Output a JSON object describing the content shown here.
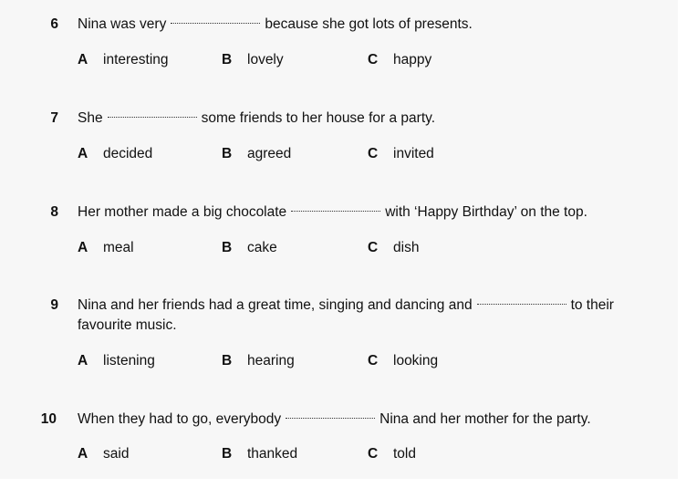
{
  "questions": [
    {
      "number": "6",
      "before": "Nina was very",
      "after": "because she got lots of presents.",
      "options": [
        {
          "letter": "A",
          "text": "interesting"
        },
        {
          "letter": "B",
          "text": "lovely"
        },
        {
          "letter": "C",
          "text": "happy"
        }
      ]
    },
    {
      "number": "7",
      "before": "She",
      "after": "some friends to her house for a party.",
      "options": [
        {
          "letter": "A",
          "text": "decided"
        },
        {
          "letter": "B",
          "text": "agreed"
        },
        {
          "letter": "C",
          "text": "invited"
        }
      ]
    },
    {
      "number": "8",
      "before": "Her mother made a big chocolate",
      "after": "with ‘Happy Birthday’ on the top.",
      "options": [
        {
          "letter": "A",
          "text": "meal"
        },
        {
          "letter": "B",
          "text": "cake"
        },
        {
          "letter": "C",
          "text": "dish"
        }
      ]
    },
    {
      "number": "9",
      "before": "Nina and her friends had a great time, singing and dancing and",
      "after": "to their favourite music.",
      "options": [
        {
          "letter": "A",
          "text": "listening"
        },
        {
          "letter": "B",
          "text": "hearing"
        },
        {
          "letter": "C",
          "text": "looking"
        }
      ]
    },
    {
      "number": "10",
      "before": "When they had to go, everybody",
      "after": "Nina and her mother for the party.",
      "options": [
        {
          "letter": "A",
          "text": "said"
        },
        {
          "letter": "B",
          "text": "thanked"
        },
        {
          "letter": "C",
          "text": "told"
        }
      ]
    }
  ]
}
